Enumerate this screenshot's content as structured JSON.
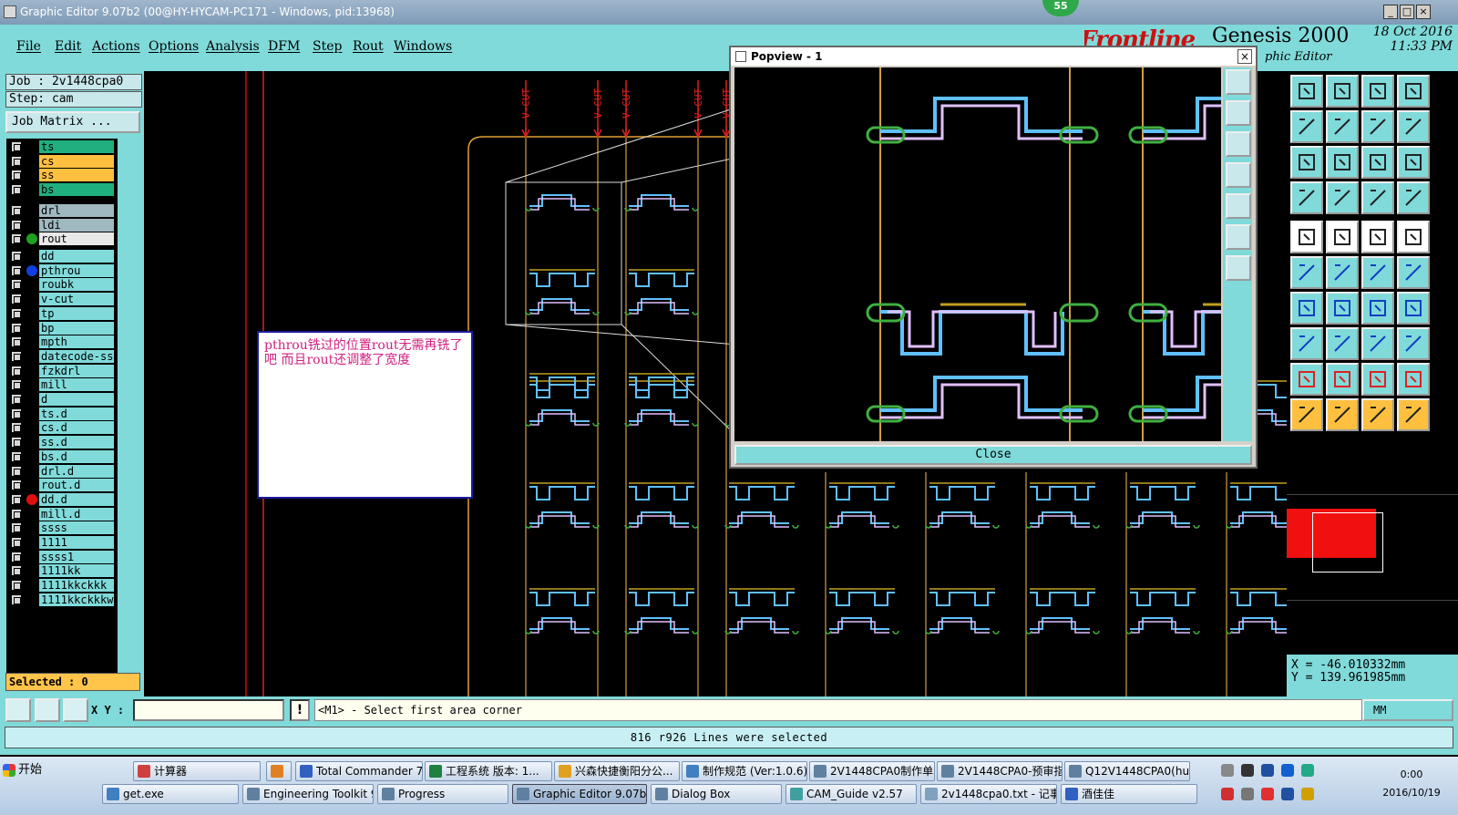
{
  "window": {
    "title": "Graphic Editor 9.07b2 (00@HY-HYCAM-PC171 - Windows, pid:13968)",
    "notification_count": "55",
    "minimize": "_",
    "maximize": "□",
    "close": "×"
  },
  "menu": [
    {
      "label": "File"
    },
    {
      "label": "Edit"
    },
    {
      "label": "Actions"
    },
    {
      "label": "Options"
    },
    {
      "label": "Analysis"
    },
    {
      "label": "DFM"
    },
    {
      "label": "Step"
    },
    {
      "label": "Rout"
    },
    {
      "label": "Windows"
    }
  ],
  "brand": {
    "logo": "Frontline",
    "title": "Genesis 2000",
    "subtitle": "phic Editor",
    "date": "18 Oct 2016",
    "time": "11:33 PM"
  },
  "job": {
    "job_label": "Job : 2v1448cpa0",
    "step_label": "Step: cam",
    "matrix_button": "Job Matrix ..."
  },
  "layers": [
    {
      "name": "ts",
      "color": "#20b080",
      "dot": ""
    },
    {
      "name": "cs",
      "color": "#ffc040",
      "dot": ""
    },
    {
      "name": "ss",
      "color": "#ffc040",
      "dot": ""
    },
    {
      "name": "bs",
      "color": "#20b080",
      "dot": ""
    },
    {
      "name": "drl",
      "color": "#a0b8c0",
      "dot": ""
    },
    {
      "name": "ldi",
      "color": "#a0b8c0",
      "dot": ""
    },
    {
      "name": "rout",
      "color": "#e8e8e8",
      "dot": "#20a020"
    },
    {
      "name": "dd",
      "color": "#80dada",
      "dot": ""
    },
    {
      "name": "pthrou",
      "color": "#80dada",
      "dot": "#1040e0"
    },
    {
      "name": "roubk",
      "color": "#80dada",
      "dot": ""
    },
    {
      "name": "v-cut",
      "color": "#80dada",
      "dot": ""
    },
    {
      "name": "tp",
      "color": "#80dada",
      "dot": ""
    },
    {
      "name": "bp",
      "color": "#80dada",
      "dot": ""
    },
    {
      "name": "mpth",
      "color": "#80dada",
      "dot": ""
    },
    {
      "name": "datecode-ss",
      "color": "#80dada",
      "dot": ""
    },
    {
      "name": "fzkdrl",
      "color": "#80dada",
      "dot": ""
    },
    {
      "name": "mill",
      "color": "#80dada",
      "dot": ""
    },
    {
      "name": "d",
      "color": "#80dada",
      "dot": ""
    },
    {
      "name": "ts.d",
      "color": "#80dada",
      "dot": ""
    },
    {
      "name": "cs.d",
      "color": "#80dada",
      "dot": ""
    },
    {
      "name": "ss.d",
      "color": "#80dada",
      "dot": ""
    },
    {
      "name": "bs.d",
      "color": "#80dada",
      "dot": ""
    },
    {
      "name": "drl.d",
      "color": "#80dada",
      "dot": ""
    },
    {
      "name": "rout.d",
      "color": "#80dada",
      "dot": ""
    },
    {
      "name": "dd.d",
      "color": "#80dada",
      "dot": "#e01010"
    },
    {
      "name": "mill.d",
      "color": "#80dada",
      "dot": ""
    },
    {
      "name": "ssss",
      "color": "#80dada",
      "dot": ""
    },
    {
      "name": "1111",
      "color": "#80dada",
      "dot": ""
    },
    {
      "name": "ssss1",
      "color": "#80dada",
      "dot": ""
    },
    {
      "name": "1111kk",
      "color": "#80dada",
      "dot": ""
    },
    {
      "name": "1111kkckkk",
      "color": "#80dada",
      "dot": ""
    },
    {
      "name": "1111kkckkkw",
      "color": "#80dada",
      "dot": ""
    }
  ],
  "selected_label": "Selected : 0",
  "canvas": {
    "vcut_label": "V-CUT",
    "annotation": "pthrou铣过的位置rout无需再铣了吧    而且rout还调整了宽度"
  },
  "popview": {
    "title": "Popview - 1",
    "close_x": "×",
    "close_button": "Close"
  },
  "coords": {
    "x": "X  = -46.010332mm",
    "y": "Y  = 139.961985mm"
  },
  "command": {
    "xy_label": "X Y :",
    "xy_value": "",
    "excl": "!",
    "prompt": "<M1> - Select first area corner",
    "units": "MM"
  },
  "status": "816 r926 Lines were selected",
  "taskbar": {
    "start": "开始",
    "row1": [
      {
        "label": "计算器",
        "active": false
      },
      {
        "label": "",
        "active": false
      },
      {
        "label": "Total Commander 7.0...",
        "active": false
      },
      {
        "label": "工程系统  版本: 1...",
        "active": false
      },
      {
        "label": "兴森快捷衡阳分公...",
        "active": false
      },
      {
        "label": "制作规范 (Ver:1.0.6)",
        "active": false
      },
      {
        "label": "2V1448CPA0制作单...",
        "active": false
      },
      {
        "label": "2V1448CPA0-预审指...",
        "active": false
      },
      {
        "label": "Q12V1448CPA0(hua...",
        "active": false
      }
    ],
    "row2": [
      {
        "label": "get.exe",
        "active": false
      },
      {
        "label": "Engineering Toolkit 9.0...",
        "active": false
      },
      {
        "label": "Progress",
        "active": false
      },
      {
        "label": "Graphic Editor 9.07b...",
        "active": true
      },
      {
        "label": "Dialog Box",
        "active": false
      },
      {
        "label": "CAM_Guide v2.57",
        "active": false
      },
      {
        "label": "2v1448cpa0.txt - 记事本",
        "active": false
      },
      {
        "label": "酒佳佳",
        "active": false
      }
    ],
    "clock_time": "0:00",
    "clock_date": "2016/10/19"
  }
}
